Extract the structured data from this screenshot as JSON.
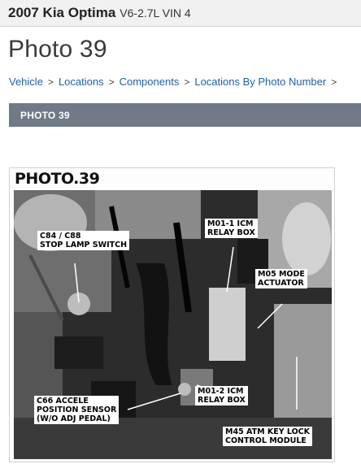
{
  "header": {
    "vehicle_name": "2007 Kia Optima",
    "vehicle_engine": "V6-2.7L VIN 4"
  },
  "page": {
    "title": "Photo 39"
  },
  "breadcrumb": {
    "items": [
      "Vehicle",
      "Locations",
      "Components",
      "Locations By Photo Number"
    ],
    "separator": ">"
  },
  "section": {
    "label": "PHOTO 39"
  },
  "photo": {
    "title": "PHOTO.39",
    "callouts": {
      "c84": [
        "C84 / C88",
        "STOP LAMP SWITCH"
      ],
      "m011": [
        "M01-1 ICM",
        "RELAY BOX"
      ],
      "m05": [
        "M05 MODE",
        "ACTUATOR"
      ],
      "c66": [
        "C66 ACCELE",
        "POSITION SENSOR",
        "(W/O ADJ PEDAL)"
      ],
      "m012": [
        "M01-2 ICM",
        "RELAY BOX"
      ],
      "m45": [
        "M45 ATM KEY LOCK",
        "CONTROL MODULE"
      ]
    }
  }
}
